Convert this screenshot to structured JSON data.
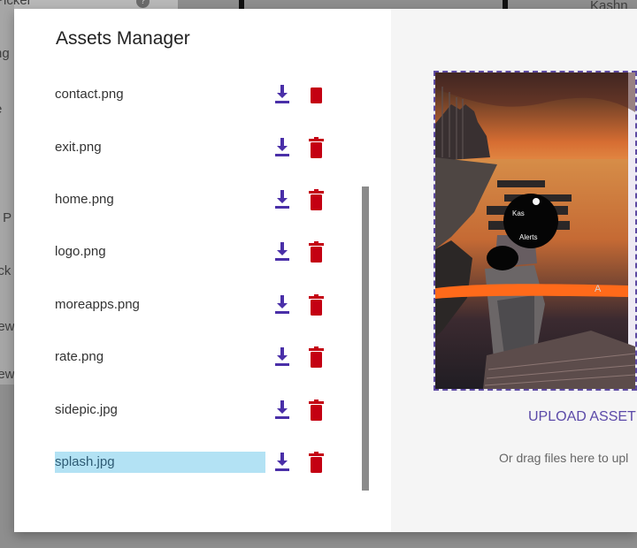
{
  "dialog": {
    "title": "Assets Manager",
    "assets": [
      {
        "name": "contact.png",
        "selected": false
      },
      {
        "name": "exit.png",
        "selected": false
      },
      {
        "name": "home.png",
        "selected": false
      },
      {
        "name": "logo.png",
        "selected": false
      },
      {
        "name": "moreapps.png",
        "selected": false
      },
      {
        "name": "rate.png",
        "selected": false
      },
      {
        "name": "sidepic.jpg",
        "selected": false
      },
      {
        "name": "splash.jpg",
        "selected": true
      }
    ],
    "upload_label": "UPLOAD ASSET",
    "drag_hint": "Or drag files here to upl",
    "preview": {
      "image_text": [
        "Kas",
        "Alerts"
      ],
      "overlay_text": "A"
    }
  },
  "background": {
    "left_labels": [
      "Picker",
      "ng",
      "e",
      "r P",
      "ick",
      "iew",
      "iew"
    ],
    "right_label": "Kashn"
  },
  "colors": {
    "accent": "#4a2fa8",
    "delete": "#c40012",
    "selected_bg": "#b3e2f4",
    "upload_text": "#5b49a8"
  },
  "icons": {
    "download": "download-icon",
    "delete": "trash-icon"
  }
}
